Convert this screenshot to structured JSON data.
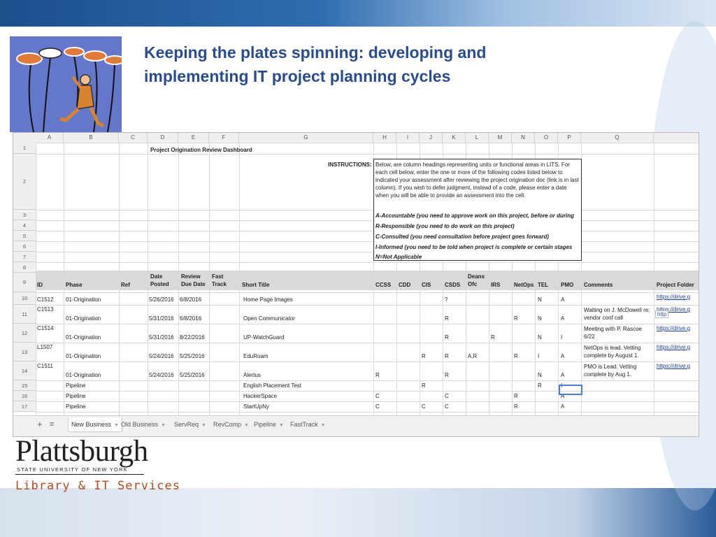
{
  "slide": {
    "title_line1": "Keeping the plates spinning: developing and",
    "title_line2": "implementing IT project planning cycles"
  },
  "logo": {
    "name": "Plattsburgh",
    "sub": "STATE UNIVERSITY OF NEW YORK",
    "dept": "Library & IT Services"
  },
  "sheet": {
    "columns": [
      "A",
      "B",
      "C",
      "D",
      "E",
      "F",
      "G",
      "H",
      "I",
      "J",
      "K",
      "L",
      "M",
      "N",
      "O",
      "P",
      "Q"
    ],
    "row_numbers": [
      "1",
      "2",
      "3",
      "4",
      "5",
      "6",
      "7",
      "8",
      "9",
      "10",
      "11",
      "12",
      "13",
      "14",
      "15",
      "16",
      "17"
    ],
    "dashboard_title": "Project Origination Review Dashboard",
    "instructions_label": "INSTRUCTIONS:",
    "instructions_text": "Below, are column headings representing units or functional areas in LITS. For each cell below, enter the one or more of the following codes listed below to indicated your assessment after reviewing the project origination doc (link is in last column). If you wish to defer judgment, instead of a code, please enter a date when you will be able to provide an assessment into the cell.",
    "codes": [
      "A-Accountable (you need to approve work on this project, before or during",
      "R-Responsible (you need to do work on this project)",
      "C-Consulted (you need consultation before project goes forward)",
      "I-Informed (you need to be told when project is complete or certain stages",
      "N=Not Applicable"
    ],
    "headers": {
      "id": "ID",
      "phase": "Phase",
      "ref": "Ref",
      "date_posted": "Date Posted",
      "review_due": "Review Due Date",
      "fast_track": "Fast Track",
      "short_title": "Short Title",
      "ccss": "CCSS",
      "cdd": "CDD",
      "cis": "CIS",
      "csds": "CSDS",
      "deans": "Deans Ofc",
      "irs": "IRS",
      "netops": "NetOps",
      "tel": "TEL",
      "pmo": "PMO",
      "comments": "Comments",
      "folder": "Project Folder"
    },
    "rows": [
      {
        "id": "C1512",
        "phase": "01-Origination",
        "posted": "5/26/2016",
        "due": "6/8/2016",
        "title": "Home Page Images",
        "ccss": "",
        "cis": "",
        "csds": "?",
        "deans": "",
        "irs": "",
        "netops": "",
        "tel": "N",
        "pmo": "A",
        "comment": "",
        "folder": "https://drive.g"
      },
      {
        "id": "C1513",
        "phase": "01-Origination",
        "posted": "5/31/2016",
        "due": "6/8/2016",
        "title": "Open Communicator",
        "ccss": "",
        "cis": "",
        "csds": "R",
        "deans": "",
        "irs": "",
        "netops": "R",
        "tel": "N",
        "pmo": "A",
        "comment": "Waiting on J. McDowell re: vendor conf call",
        "folder": "https://drive.g"
      },
      {
        "id": "C1514",
        "phase": "01-Origination",
        "posted": "5/31/2016",
        "due": "8/22/2016",
        "title": "UP-WatchGuard",
        "ccss": "",
        "cis": "",
        "csds": "R",
        "deans": "",
        "irs": "R",
        "netops": "",
        "tel": "N",
        "pmo": "I",
        "comment": "Meeting with P. Rascoe 6/22",
        "folder": "https://drive.g"
      },
      {
        "id": "L1507",
        "phase": "01-Origination",
        "posted": "5/24/2016",
        "due": "5/25/2016",
        "title": "EduRoam",
        "ccss": "",
        "cis": "R",
        "csds": "R",
        "deans": "A,R",
        "irs": "",
        "netops": "R",
        "tel": "I",
        "pmo": "A",
        "comment": "NetOps is lead. Vetting complete by August 1.",
        "folder": "https://drive.g"
      },
      {
        "id": "C1511",
        "phase": "01-Origination",
        "posted": "5/24/2016",
        "due": "5/25/2016",
        "title": "Alertus",
        "ccss": "R",
        "cis": "",
        "csds": "R",
        "deans": "",
        "irs": "",
        "netops": "",
        "tel": "N",
        "pmo": "A",
        "comment": "PMO is Lead. Vetting complete by Aug 1.",
        "folder": "https://drive.g"
      },
      {
        "id": "",
        "phase": "Pipeline",
        "posted": "",
        "due": "",
        "title": "English Placement Test",
        "ccss": "",
        "cis": "R",
        "csds": "",
        "deans": "",
        "irs": "",
        "netops": "",
        "tel": "R",
        "pmo": "I",
        "comment": "",
        "folder": ""
      },
      {
        "id": "",
        "phase": "Pipeline",
        "posted": "",
        "due": "",
        "title": "HackerSpace",
        "ccss": "C",
        "cis": "",
        "csds": "C",
        "deans": "",
        "irs": "",
        "netops": "R",
        "tel": "",
        "pmo": "A",
        "comment": "",
        "folder": ""
      },
      {
        "id": "",
        "phase": "Pipeline",
        "posted": "",
        "due": "",
        "title": "StartUpNy",
        "ccss": "C",
        "cis": "C",
        "csds": "C",
        "deans": "",
        "irs": "",
        "netops": "R",
        "tel": "",
        "pmo": "A",
        "comment": "",
        "folder": ""
      }
    ],
    "tooltip": "http",
    "tabs": [
      "New Business",
      "Old Business",
      "ServReq",
      "RevComp",
      "Pipeline",
      "FastTrack"
    ],
    "add_sheet": "+",
    "all_sheets": "≡"
  }
}
